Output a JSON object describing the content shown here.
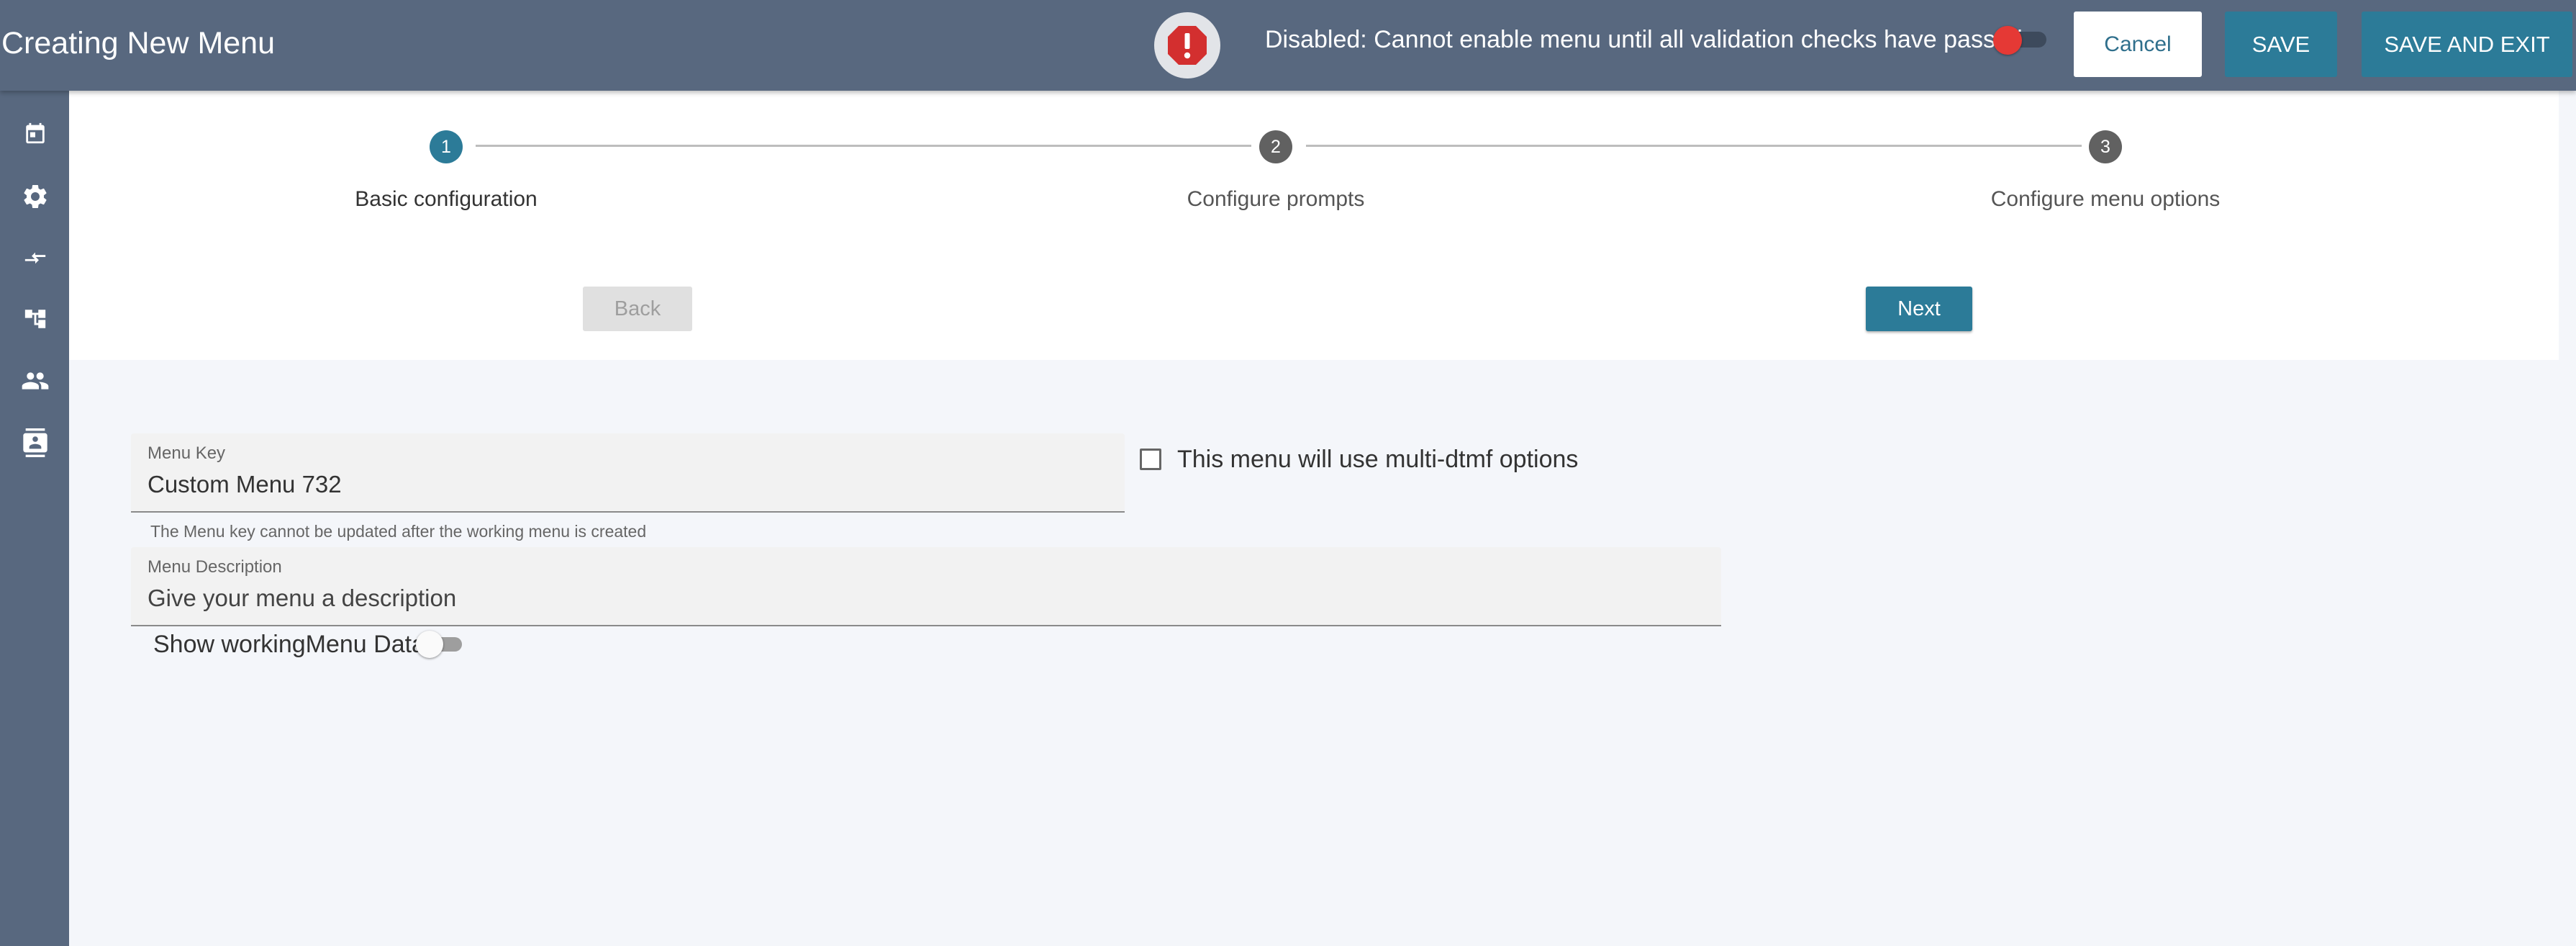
{
  "header": {
    "title": "Creating New Menu",
    "alert_icon": "error-octagon-icon",
    "status_text": "Disabled: Cannot enable menu until all validation checks have passed",
    "enable_toggle_on": false,
    "cancel_label": "Cancel",
    "save_label": "SAVE",
    "save_exit_label": "SAVE AND EXIT"
  },
  "sidebar": {
    "items": [
      {
        "icon": "calendar-icon"
      },
      {
        "icon": "gear-icon"
      },
      {
        "icon": "transfer-arrows-icon"
      },
      {
        "icon": "hierarchy-icon"
      },
      {
        "icon": "people-icon"
      },
      {
        "icon": "contact-card-icon"
      }
    ]
  },
  "stepper": {
    "steps": [
      {
        "number": "1",
        "label": "Basic configuration",
        "active": true
      },
      {
        "number": "2",
        "label": "Configure prompts",
        "active": false
      },
      {
        "number": "3",
        "label": "Configure menu options",
        "active": false
      }
    ],
    "back_label": "Back",
    "next_label": "Next"
  },
  "form": {
    "menu_key": {
      "label": "Menu Key",
      "value": "Custom Menu 732",
      "helper": "The Menu key cannot be updated after the working menu is created"
    },
    "multi_dtmf": {
      "label": "This menu will use multi-dtmf options",
      "checked": false
    },
    "menu_description": {
      "label": "Menu Description",
      "placeholder": "Give your menu a description"
    },
    "show_data": {
      "label": "Show workingMenu Data",
      "on": false
    }
  },
  "colors": {
    "header_bg": "#58687f",
    "accent": "#2c7b98",
    "error": "#e53935",
    "step_inactive": "#616161"
  }
}
